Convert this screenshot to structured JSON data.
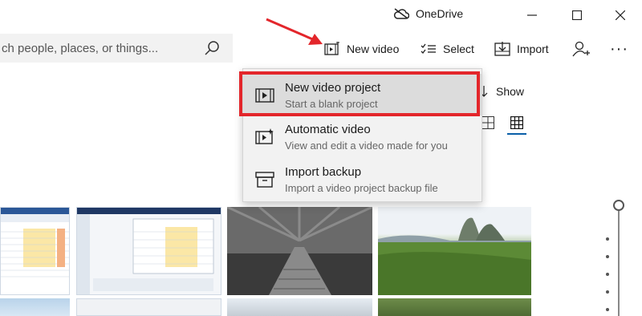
{
  "titlebar": {
    "onedrive_label": "OneDrive",
    "icons": [
      "onedrive-cloud-icon",
      "minimize-icon",
      "maximize-icon",
      "close-icon"
    ]
  },
  "search": {
    "placeholder": "ch people, places, or things...",
    "icon": "search-icon"
  },
  "toolbar": {
    "new_video_label": "New video",
    "select_label": "Select",
    "import_label": "Import",
    "more_label": "···"
  },
  "view": {
    "show_label": "Show"
  },
  "menu": {
    "items": [
      {
        "title": "New video project",
        "subtitle": "Start a blank project",
        "icon": "video-project-icon"
      },
      {
        "title": "Automatic video",
        "subtitle": "View and edit a video made for you",
        "icon": "automatic-video-icon"
      },
      {
        "title": "Import backup",
        "subtitle": "Import a video project backup file",
        "icon": "archive-icon"
      }
    ]
  },
  "colors": {
    "highlight": "#e3262b",
    "accent": "#0a5fa8",
    "menu_bg": "#f2f2f2"
  }
}
